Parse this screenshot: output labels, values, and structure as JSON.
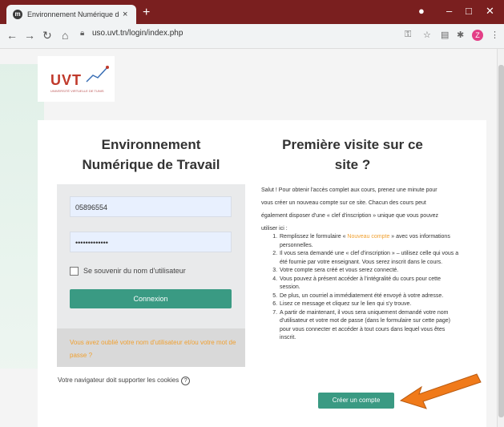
{
  "browser": {
    "tab_title": "Environnement Numérique de Tr",
    "tab_close": "×",
    "new_tab": "+",
    "url": "uso.uvt.tn/login/index.php",
    "avatar_letter": "Z",
    "title_bar_color": "#7a1f1f"
  },
  "logo": {
    "text": "UVT",
    "subtitle": "UNIVERSITÉ VIRTUELLE DE TUNIS"
  },
  "login": {
    "heading_line1": "Environnement",
    "heading_line2": "Numérique de Travail",
    "username_value": "05896554",
    "password_value": "•••••••••••••",
    "remember_label": "Se souvenir du nom d'utilisateur",
    "connect_button": "Connexion",
    "forgot_text": "Vous avez oublié votre nom d'utilisateur et/ou votre mot de passe ?",
    "cookies_text": "Votre navigateur doit supporter les cookies",
    "help_icon": "question-icon",
    "accent_color": "#3a9a83"
  },
  "signup": {
    "heading_line1": "Première visite sur ce",
    "heading_line2": "site ?",
    "intro": "Salut ! Pour obtenir l'accès complet aux cours, prenez une minute pour vous créer un nouveau compte sur ce site. Chacun des cours peut également disposer d'une « clef d'inscription » unique que vous pouvez utiliser ici :",
    "step1_pre": "Remplissez le formulaire « ",
    "step1_link": "Nouveau compte",
    "step1_post": " » avec vos informations personnelles.",
    "steps": [
      "Il vous sera demandé une « clef d'inscription » – utilisez celle qui vous a été fournie par votre enseignant. Vous serez inscrit dans le cours.",
      "Votre compte sera créé et vous serez connecté.",
      "Vous pouvez à présent accéder à l'intégralité du cours pour cette session.",
      "De plus, un courriel a immédiatement été envoyé à votre adresse.",
      "Lisez ce message et cliquez sur le lien qui s'y trouve.",
      "A partir de maintenant, il vous sera uniquement demandé votre nom d'utilisateur et votre mot de passe (dans le formulaire sur cette page) pour vous connecter et accéder à tout cours dans lequel vous êtes inscrit."
    ],
    "create_button": "Créer un compte",
    "arrow_color": "#f07a1a"
  }
}
